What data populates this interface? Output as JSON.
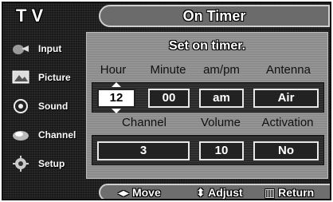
{
  "header": {
    "tv_label": "TV",
    "title": "On Timer"
  },
  "sidebar": {
    "items": [
      {
        "label": "Input",
        "icon": "input-icon"
      },
      {
        "label": "Picture",
        "icon": "picture-icon"
      },
      {
        "label": "Sound",
        "icon": "sound-icon"
      },
      {
        "label": "Channel",
        "icon": "channel-icon"
      },
      {
        "label": "Setup",
        "icon": "setup-icon"
      }
    ]
  },
  "panel": {
    "subtitle": "Set on timer.",
    "row1_labels": {
      "hour": "Hour",
      "minute": "Minute",
      "ampm": "am/pm",
      "antenna": "Antenna"
    },
    "row1_values": {
      "hour": "12",
      "minute": "00",
      "ampm": "am",
      "antenna": "Air"
    },
    "row2_labels": {
      "channel": "Channel",
      "volume": "Volume",
      "activation": "Activation"
    },
    "row2_values": {
      "channel": "3",
      "volume": "10",
      "activation": "No"
    }
  },
  "footer": {
    "move": "Move",
    "adjust": "Adjust",
    "return": "Return"
  },
  "colors": {
    "background": "#1a1a1a",
    "panel": "#8c8c8c",
    "selected_field": "#ffffff"
  }
}
